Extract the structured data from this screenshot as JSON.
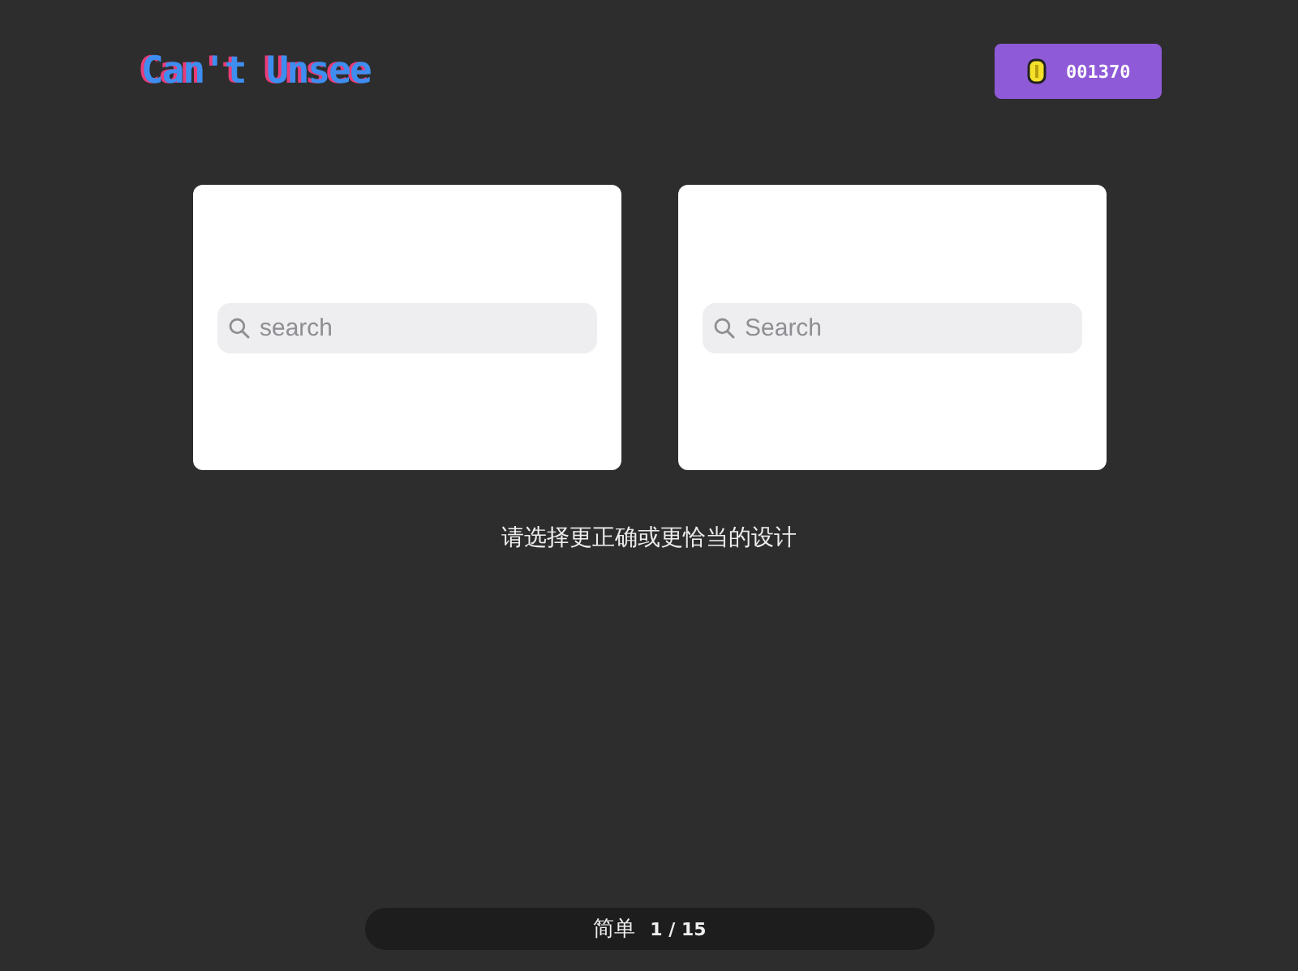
{
  "logo": "Can't Unsee",
  "coins": "001370",
  "options": [
    {
      "search": {
        "placeholder": "search"
      }
    },
    {
      "search": {
        "placeholder": "Search"
      }
    }
  ],
  "prompt": "请选择更正确或更恰当的设计",
  "progress": {
    "level_name": "简单",
    "current": "1",
    "separator": "/",
    "total": "15"
  }
}
